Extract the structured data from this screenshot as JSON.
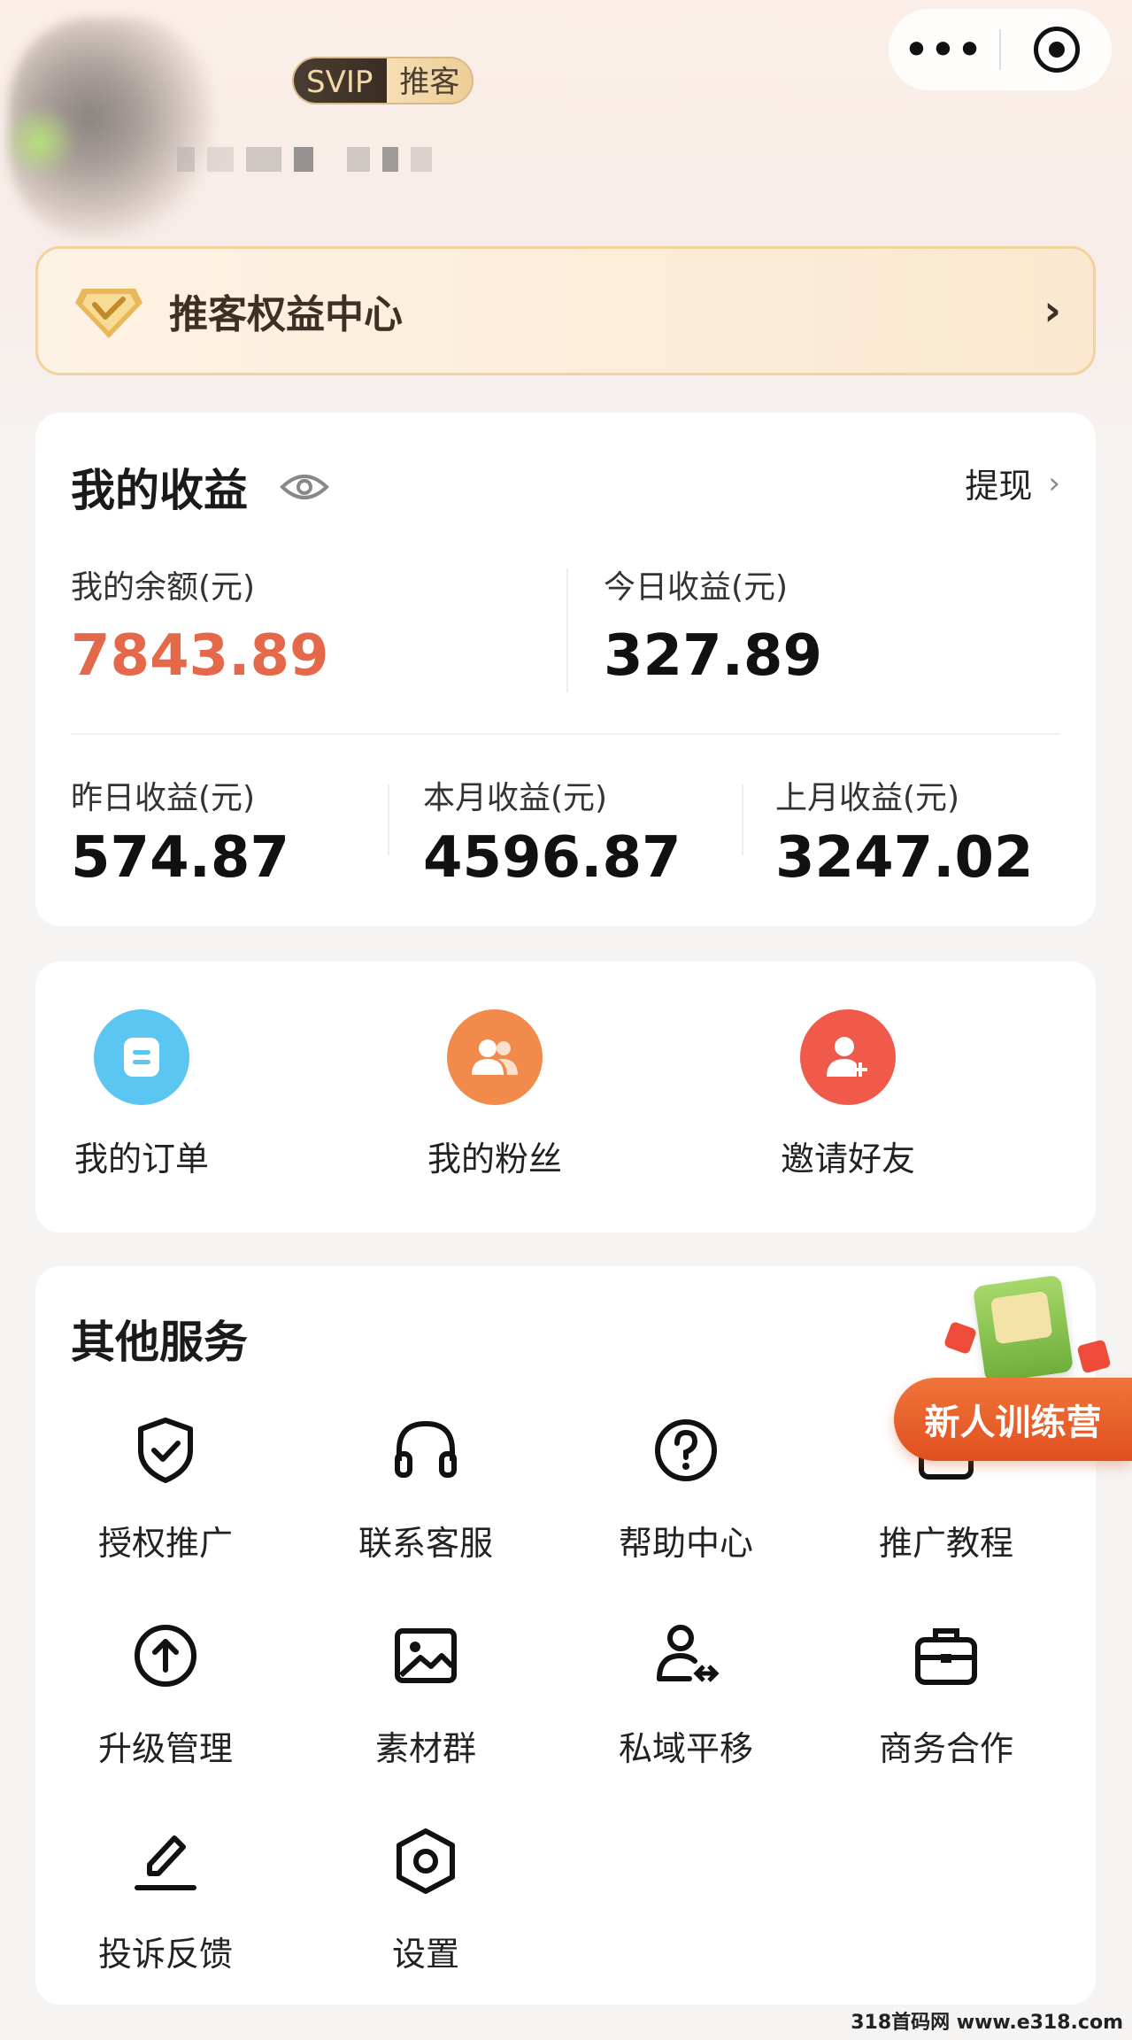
{
  "header": {
    "badge_svip": "SVIP",
    "badge_role": "推客",
    "more_icon": "more-dots-icon",
    "close_icon": "target-circle-icon"
  },
  "rights_banner": {
    "title": "推客权益中心",
    "chevron": "›"
  },
  "earnings": {
    "title": "我的收益",
    "withdraw": "提现",
    "withdraw_chevron": "›",
    "balance_label": "我的余额(元)",
    "balance_value": "7843.89",
    "today_label": "今日收益(元)",
    "today_value": "327.89",
    "yesterday_label": "昨日收益(元)",
    "yesterday_value": "574.87",
    "month_label": "本月收益(元)",
    "month_value": "4596.87",
    "last_month_label": "上月收益(元)",
    "last_month_value": "3247.02",
    "accent_color": "#e4694a"
  },
  "quick_actions": [
    {
      "label": "我的订单",
      "icon": "order-icon",
      "color": "#5cc6f2"
    },
    {
      "label": "我的粉丝",
      "icon": "fans-icon",
      "color": "#f28a4b"
    },
    {
      "label": "邀请好友",
      "icon": "invite-friend-icon",
      "color": "#ef5a4a"
    }
  ],
  "services": {
    "title": "其他服务",
    "items": [
      {
        "label": "授权推广",
        "icon": "shield-check-icon"
      },
      {
        "label": "联系客服",
        "icon": "headset-icon"
      },
      {
        "label": "帮助中心",
        "icon": "help-circle-icon"
      },
      {
        "label": "推广教程",
        "icon": "tutorial-icon"
      },
      {
        "label": "升级管理",
        "icon": "upgrade-arrow-icon"
      },
      {
        "label": "素材群",
        "icon": "image-icon"
      },
      {
        "label": "私域平移",
        "icon": "user-transfer-icon"
      },
      {
        "label": "商务合作",
        "icon": "briefcase-icon"
      },
      {
        "label": "投诉反馈",
        "icon": "pen-icon"
      },
      {
        "label": "设置",
        "icon": "settings-hexagon-icon"
      }
    ]
  },
  "float_banner": {
    "label": "新人训练营"
  },
  "watermark": "318首码网 www.e318.com"
}
